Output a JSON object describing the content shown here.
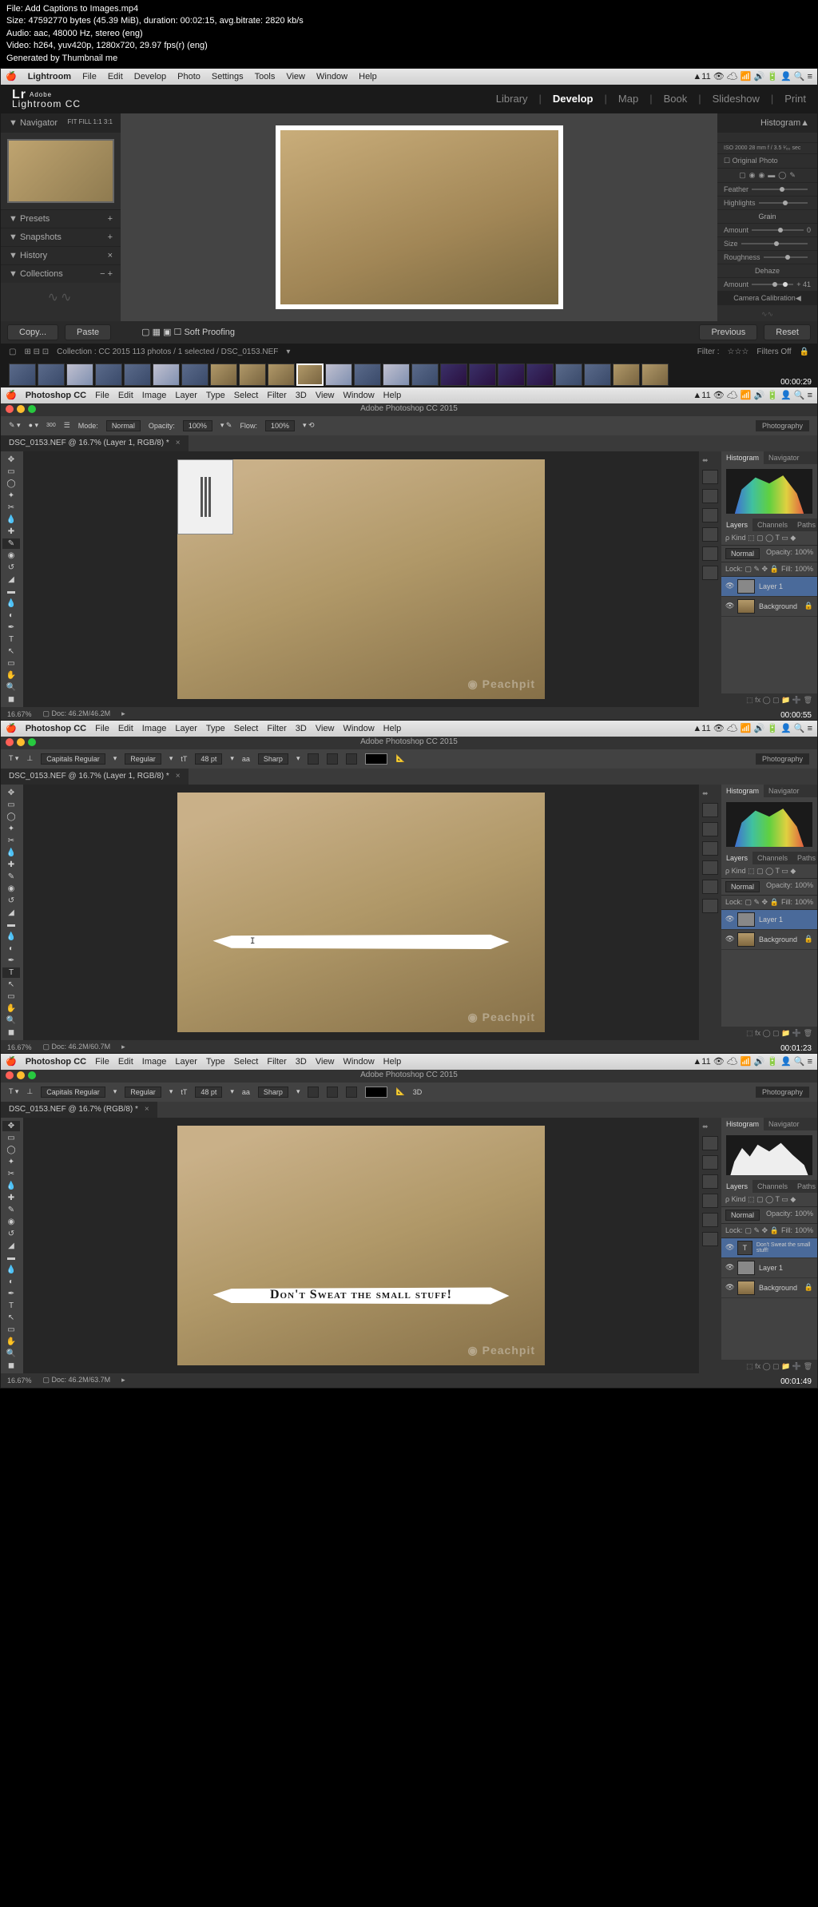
{
  "fileinfo": {
    "l1": "File: Add Captions to Images.mp4",
    "l2": "Size: 47592770 bytes (45.39 MiB), duration: 00:02:15, avg.bitrate: 2820 kb/s",
    "l3": "Audio: aac, 48000 Hz, stereo (eng)",
    "l4": "Video: h264, yuv420p, 1280x720, 29.97 fps(r) (eng)",
    "l5": "Generated by Thumbnail me"
  },
  "lr": {
    "menu": [
      "Lightroom",
      "File",
      "Edit",
      "Develop",
      "Photo",
      "Settings",
      "Tools",
      "View",
      "Window",
      "Help"
    ],
    "logo_small": "Adobe",
    "logo": "Lightroom CC",
    "tabs": [
      "Library",
      "Develop",
      "Map",
      "Book",
      "Slideshow",
      "Print"
    ],
    "active_tab": "Develop",
    "left": {
      "nav": "Navigator",
      "nav_opts": "FIT  FILL  1:1  3:1",
      "items": [
        "Presets",
        "Snapshots",
        "History",
        "Collections"
      ]
    },
    "right": {
      "hdr": "Histogram",
      "iso": "ISO 2000    28 mm    f / 3.5    ¹⁄₆₀ sec",
      "orig": "Original Photo",
      "grain": "Grain",
      "amount": "Amount",
      "size": "Size",
      "rough": "Roughness",
      "dehaze": "Dehaze",
      "dehaze_val": "+ 41",
      "calib": "Camera Calibration"
    },
    "bottom": {
      "copy": "Copy...",
      "paste": "Paste",
      "soft": "Soft Proofing",
      "prev": "Previous",
      "reset": "Reset"
    },
    "film": {
      "coll": "Collection : CC 2015    113 photos / 1 selected / DSC_0153.NEF",
      "filter": "Filter :",
      "off": "Filters Off"
    },
    "ts": "00:00:29"
  },
  "ps_menu": [
    "Photoshop CC",
    "File",
    "Edit",
    "Image",
    "Layer",
    "Type",
    "Select",
    "Filter",
    "3D",
    "View",
    "Window",
    "Help"
  ],
  "ps_title": "Adobe Photoshop CC 2015",
  "ps_right_label": "Photography",
  "watermark": "Peachpit",
  "ps1": {
    "tab": "DSC_0153.NEF @ 16.7% (Layer 1, RGB/8) *",
    "opts": {
      "mode": "Mode:",
      "normal": "Normal",
      "opacity": "Opacity:",
      "op_val": "100%",
      "flow": "Flow:",
      "fl_val": "100%"
    },
    "layers": [
      {
        "name": "Layer 1",
        "sel": true
      },
      {
        "name": "Background"
      }
    ],
    "lopts": {
      "normal": "Normal",
      "opacity": "Opacity:",
      "op_val": "100%",
      "lock": "Lock:",
      "fill": "Fill:",
      "fi_val": "100%",
      "kind": "Kind"
    },
    "status": {
      "zoom": "16.67%",
      "doc": "Doc: 46.2M/46.2M"
    },
    "ts": "00:00:55"
  },
  "ps2": {
    "tab": "DSC_0153.NEF @ 16.7% (Layer 1, RGB/8) *",
    "opts": {
      "font": "Capitals Regular",
      "style": "Regular",
      "size": "48 pt",
      "aa": "Sharp"
    },
    "layers": [
      {
        "name": "Layer 1",
        "sel": true
      },
      {
        "name": "Background"
      }
    ],
    "status": {
      "zoom": "16.67%",
      "doc": "Doc: 46.2M/60.7M"
    },
    "ts": "00:01:23"
  },
  "ps3": {
    "tab": "DSC_0153.NEF @ 16.7% (RGB/8) *",
    "opts": {
      "font": "Capitals Regular",
      "style": "Regular",
      "size": "48 pt",
      "aa": "Sharp"
    },
    "caption": "Don't Sweat the small stuff!",
    "layers": [
      {
        "name": "Don't Sweat the small stuff!",
        "sel": true,
        "type": "T"
      },
      {
        "name": "Layer 1"
      },
      {
        "name": "Background"
      }
    ],
    "status": {
      "zoom": "16.67%",
      "doc": "Doc: 46.2M/63.7M"
    },
    "ts": "00:01:49"
  },
  "panels": {
    "histo": "Histogram",
    "nav": "Navigator",
    "layers": "Layers",
    "channels": "Channels",
    "paths": "Paths"
  }
}
